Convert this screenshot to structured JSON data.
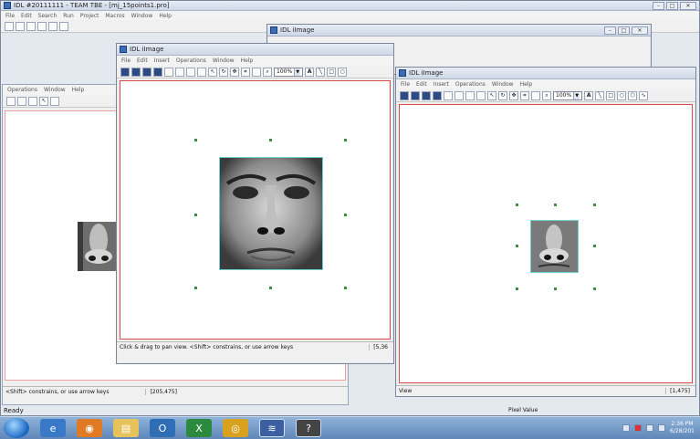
{
  "main_window": {
    "title": "IDL #20111111 - TEAM TBE - [mj_15points1.pro]",
    "menu": [
      "File",
      "Edit",
      "Search",
      "Run",
      "Project",
      "Macros",
      "Window",
      "Help"
    ]
  },
  "back_window": {
    "title": "IDL iImage"
  },
  "left_panel": {
    "menu": [
      "Operations",
      "Window",
      "Help"
    ],
    "status_text": "<Shift> constrains, or use arrow keys",
    "coords": "[205,475]"
  },
  "image_window_1": {
    "title": "IDL iImage",
    "menu": [
      "File",
      "Edit",
      "Insert",
      "Operations",
      "Window",
      "Help"
    ],
    "zoom": "100%",
    "status_text": "Click & drag to pan view. <Shift> constrains, or use arrow keys",
    "coords": "[5,36"
  },
  "image_window_2": {
    "title": "IDL iImage",
    "menu": [
      "File",
      "Edit",
      "Insert",
      "Operations",
      "Window",
      "Help"
    ],
    "zoom": "100%",
    "status_text": "View",
    "coords": "[1,475]"
  },
  "bottom": {
    "ready": "Ready",
    "pixel_value": "Pixel Value"
  },
  "tray": {
    "time": "2:36 PM",
    "date": "6/28/201"
  },
  "icons": {
    "search": "search-icon",
    "arrow": "arrow-icon",
    "rotate": "rotate-icon",
    "crop": "crop-icon",
    "text": "text-icon",
    "line": "line-icon",
    "rect": "rectangle-icon",
    "oval": "oval-icon",
    "polygon": "polygon-icon",
    "freehand": "freehand-icon"
  },
  "colors": {
    "border_red": "#d94a4a",
    "roi_green": "#3e8f3e",
    "title_blue": "#cdd7e6"
  }
}
